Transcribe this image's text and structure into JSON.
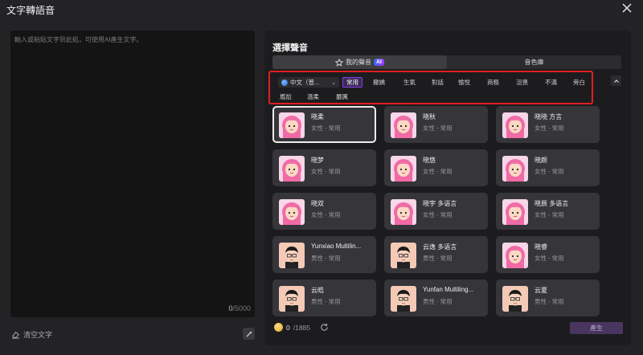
{
  "window": {
    "title": "文字轉語音"
  },
  "editor": {
    "placeholder": "輸入或粘貼文字到此処，可使用AI產生文字。",
    "value": "",
    "char_count": "0",
    "char_limit": "/5000",
    "clear_label": "清空文字"
  },
  "voice_panel": {
    "title": "選擇聲音",
    "tabs": [
      {
        "label": "我的聲音",
        "badge": "AI",
        "icon": "star-icon"
      },
      {
        "label": "音色庫"
      }
    ],
    "language_select": {
      "value": "中文（普...",
      "icon": "globe-icon"
    },
    "filters": [
      "常用",
      "撒嬌",
      "生氣",
      "對話",
      "愉悅",
      "商務",
      "沮喪",
      "不滿",
      "旁白",
      "尷尬",
      "溫柔",
      "嚴厲"
    ],
    "active_filter": "常用",
    "voices": [
      {
        "name": "晓柔",
        "meta": "女性 - 常用",
        "gender": "female"
      },
      {
        "name": "晓秋",
        "meta": "女性 - 常用",
        "gender": "female"
      },
      {
        "name": "晓晓 方言",
        "meta": "女性 - 常用",
        "gender": "female"
      },
      {
        "name": "晓梦",
        "meta": "女性 - 常用",
        "gender": "female"
      },
      {
        "name": "晓悠",
        "meta": "女性 - 常用",
        "gender": "female"
      },
      {
        "name": "晓颜",
        "meta": "女性 - 常用",
        "gender": "female"
      },
      {
        "name": "晓双",
        "meta": "女性 - 常用",
        "gender": "female"
      },
      {
        "name": "晓宇 多语言",
        "meta": "女性 - 常用",
        "gender": "female"
      },
      {
        "name": "晓辰 多语言",
        "meta": "女性 - 常用",
        "gender": "female"
      },
      {
        "name": "Yunxiao Multilin...",
        "meta": "男性 - 常用",
        "gender": "male"
      },
      {
        "name": "云逸 多语言",
        "meta": "男性 - 常用",
        "gender": "male"
      },
      {
        "name": "晓睿",
        "meta": "女性 - 常用",
        "gender": "female"
      },
      {
        "name": "云皓",
        "meta": "男性 - 常用",
        "gender": "male"
      },
      {
        "name": "Yunfan Multiling...",
        "meta": "男性 - 常用",
        "gender": "male"
      },
      {
        "name": "云夏",
        "meta": "男性 - 常用",
        "gender": "male"
      }
    ],
    "credits": {
      "current": "0",
      "total": "/1885"
    },
    "generate_label": "產生"
  },
  "colors": {
    "accent": "#8a3df0",
    "highlight_box": "#e02020",
    "panel": "#1c1c1f",
    "card": "#35353a"
  }
}
